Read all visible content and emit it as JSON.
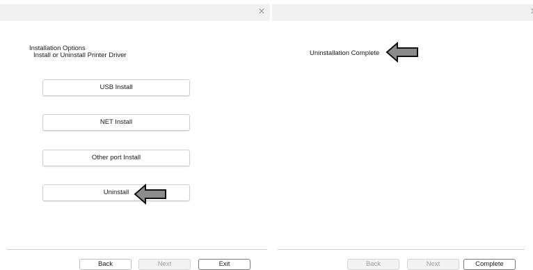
{
  "left_window": {
    "close_glyph": "×",
    "options_title": "Installation Options",
    "options_subtitle": "Install or Uninstall Printer Driver",
    "buttons": [
      {
        "label": "USB Install"
      },
      {
        "label": "NET Install"
      },
      {
        "label": "Other port Install"
      },
      {
        "label": "Uninstall"
      }
    ],
    "nav": {
      "back": "Back",
      "next": "Next",
      "exit": "Exit"
    },
    "annotation": "arrow-pointing-at-uninstall"
  },
  "right_window": {
    "close_glyph": "×",
    "message": "Uninstallation Complete",
    "nav": {
      "back": "Back",
      "next": "Next",
      "complete": "Complete"
    },
    "annotation": "arrow-pointing-at-message"
  },
  "colors": {
    "arrow_fill": "#8c8c8c",
    "titlebar": "#f0f0f0"
  }
}
